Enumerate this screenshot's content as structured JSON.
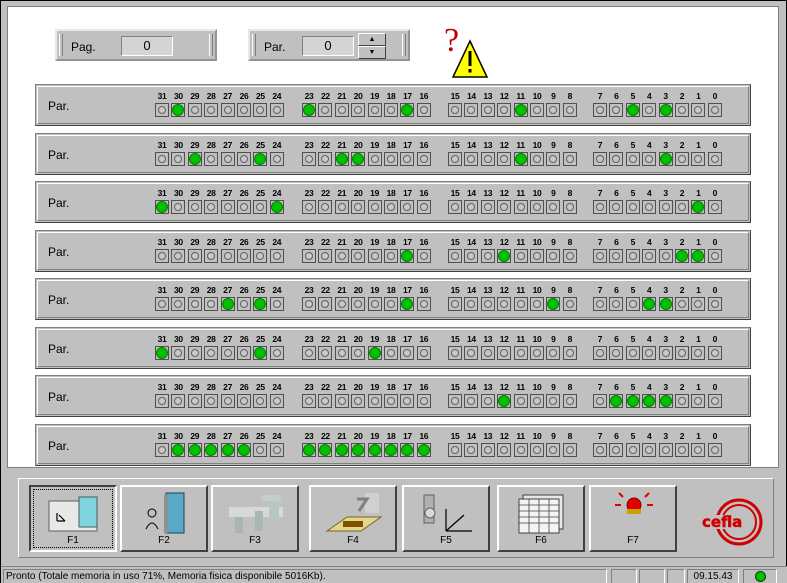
{
  "header": {
    "pag_label": "Pag.",
    "pag_value": "0",
    "par_label": "Par.",
    "par_value": "0",
    "spin_up": "▲",
    "spin_down": "▼",
    "warning_icon": "question-warning-icon"
  },
  "bit_groups": [
    [
      "31",
      "30",
      "29",
      "28",
      "27",
      "26",
      "25",
      "24"
    ],
    [
      "23",
      "22",
      "21",
      "20",
      "19",
      "18",
      "17",
      "16"
    ],
    [
      "15",
      "14",
      "13",
      "12",
      "11",
      "10",
      "9",
      "8"
    ],
    [
      "7",
      "6",
      "5",
      "4",
      "3",
      "2",
      "1",
      "0"
    ]
  ],
  "rows": [
    {
      "label": "Par.",
      "bits": [
        [
          0,
          1,
          0,
          0,
          0,
          0,
          0,
          0
        ],
        [
          1,
          0,
          0,
          0,
          0,
          0,
          1,
          0
        ],
        [
          0,
          0,
          0,
          0,
          1,
          0,
          0,
          0
        ],
        [
          0,
          0,
          1,
          0,
          1,
          0,
          0,
          0
        ]
      ]
    },
    {
      "label": "Par.",
      "bits": [
        [
          0,
          0,
          1,
          0,
          0,
          0,
          1,
          0
        ],
        [
          0,
          0,
          1,
          1,
          0,
          0,
          0,
          0
        ],
        [
          0,
          0,
          0,
          0,
          1,
          0,
          0,
          0
        ],
        [
          0,
          0,
          0,
          0,
          1,
          0,
          0,
          0
        ]
      ]
    },
    {
      "label": "Par.",
      "bits": [
        [
          1,
          0,
          0,
          0,
          0,
          0,
          0,
          1
        ],
        [
          0,
          0,
          0,
          0,
          0,
          0,
          0,
          0
        ],
        [
          0,
          0,
          0,
          0,
          0,
          0,
          0,
          0
        ],
        [
          0,
          0,
          0,
          0,
          0,
          0,
          1,
          0
        ]
      ]
    },
    {
      "label": "Par.",
      "bits": [
        [
          0,
          0,
          0,
          0,
          0,
          0,
          0,
          0
        ],
        [
          0,
          0,
          0,
          0,
          0,
          0,
          1,
          0
        ],
        [
          0,
          0,
          0,
          1,
          0,
          0,
          0,
          0
        ],
        [
          0,
          0,
          0,
          0,
          0,
          1,
          1,
          0
        ]
      ]
    },
    {
      "label": "Par.",
      "bits": [
        [
          0,
          0,
          0,
          0,
          1,
          0,
          1,
          0
        ],
        [
          0,
          0,
          0,
          0,
          0,
          0,
          1,
          0
        ],
        [
          0,
          0,
          0,
          0,
          0,
          0,
          1,
          0
        ],
        [
          0,
          0,
          0,
          1,
          1,
          0,
          0,
          0
        ]
      ]
    },
    {
      "label": "Par.",
      "bits": [
        [
          1,
          0,
          0,
          0,
          0,
          0,
          1,
          0
        ],
        [
          0,
          0,
          0,
          0,
          1,
          0,
          0,
          0
        ],
        [
          0,
          0,
          0,
          0,
          0,
          0,
          0,
          0
        ],
        [
          0,
          0,
          0,
          0,
          0,
          0,
          0,
          0
        ]
      ]
    },
    {
      "label": "Par.",
      "bits": [
        [
          0,
          0,
          0,
          0,
          0,
          0,
          0,
          0
        ],
        [
          0,
          0,
          0,
          0,
          0,
          0,
          0,
          0
        ],
        [
          0,
          0,
          0,
          1,
          0,
          0,
          0,
          0
        ],
        [
          0,
          1,
          1,
          1,
          1,
          0,
          0,
          0
        ]
      ]
    },
    {
      "label": "Par.",
      "bits": [
        [
          0,
          1,
          1,
          1,
          1,
          1,
          0,
          0
        ],
        [
          1,
          1,
          1,
          1,
          1,
          1,
          1,
          1
        ],
        [
          0,
          0,
          0,
          0,
          0,
          0,
          0,
          0
        ],
        [
          0,
          0,
          0,
          0,
          0,
          0,
          0,
          0
        ]
      ]
    }
  ],
  "function_keys": [
    {
      "label": "F1",
      "icon": "machine-overview-icon",
      "selected": true
    },
    {
      "label": "F2",
      "icon": "operator-panel-icon",
      "selected": false
    },
    {
      "label": "F3",
      "icon": "robot-line-icon",
      "selected": false
    },
    {
      "label": "F4",
      "icon": "spray-booth-icon",
      "selected": false
    },
    {
      "label": "F5",
      "icon": "robot-chart-icon",
      "selected": false
    },
    {
      "label": "F6",
      "icon": "data-tables-icon",
      "selected": false
    },
    {
      "label": "F7",
      "icon": "alarm-siren-icon",
      "selected": false
    }
  ],
  "logo": "cefla",
  "status": {
    "message": "Pronto (Totale memoria in uso 71%, Memoria fisica disponibile 5016Kb).",
    "time": "09.15.43",
    "led_color": "#00c000"
  },
  "colors": {
    "led_on": "#00c000",
    "led_off": "#c8c8c8",
    "warning": "#ffff00",
    "question": "#c00000",
    "logo": "#d00000"
  }
}
